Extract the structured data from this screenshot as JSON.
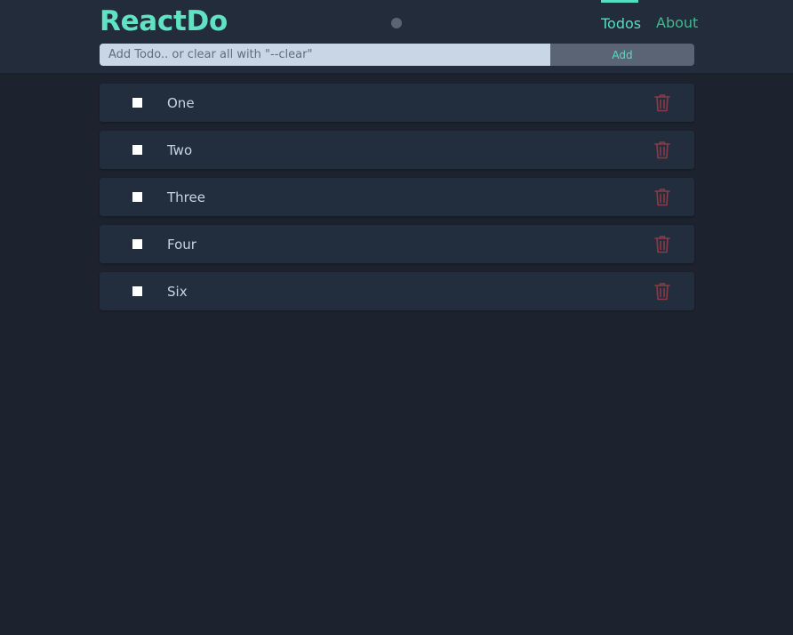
{
  "app": {
    "brand": "ReactDo"
  },
  "nav": {
    "items": [
      {
        "label": "Todos",
        "active": true
      },
      {
        "label": "About",
        "active": false
      }
    ]
  },
  "form": {
    "input_value": "",
    "placeholder": "Add Todo.. or clear all with \"--clear\"",
    "add_label": "Add"
  },
  "todos": [
    {
      "text": "One",
      "done": false,
      "delete_icon": "trash-icon"
    },
    {
      "text": "Two",
      "done": false,
      "delete_icon": "trash-icon"
    },
    {
      "text": "Three",
      "done": false,
      "delete_icon": "trash-icon"
    },
    {
      "text": "Four",
      "done": false,
      "delete_icon": "trash-icon"
    },
    {
      "text": "Six",
      "done": false,
      "delete_icon": "trash-icon"
    }
  ],
  "colors": {
    "background": "#1c222e",
    "header": "#222c3b",
    "accent": "#5fe3c3",
    "nav_link": "#3fb98f",
    "card": "#222e3e",
    "delete": "#8c3a47",
    "input_bg": "#c9d6e6",
    "button_bg": "#5a6474"
  }
}
